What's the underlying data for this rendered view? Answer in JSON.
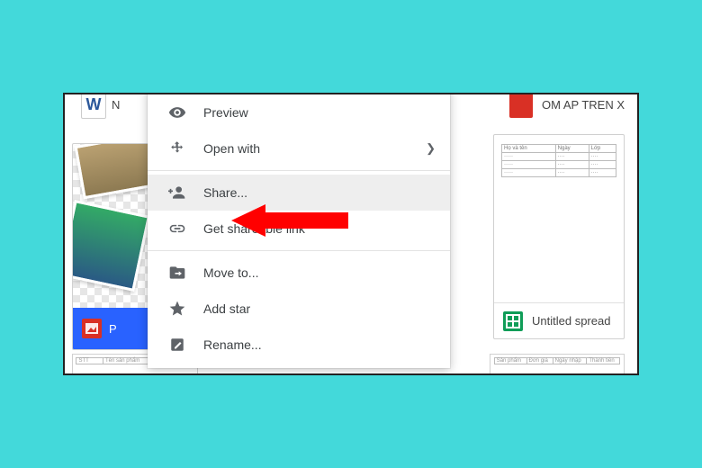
{
  "top_left": {
    "w_label": "W",
    "name_fragment": "N"
  },
  "top_right": {
    "name_fragment": "OM AP TREN X"
  },
  "photo_card": {
    "footer_label": "P"
  },
  "right_card": {
    "footer_label": "Untitled spread",
    "table_headers": [
      "Họ và tên",
      "Ngày",
      "Lớp"
    ]
  },
  "context_menu": {
    "preview": "Preview",
    "open_with": "Open with",
    "share": "Share...",
    "get_link": "Get shareable link",
    "move_to": "Move to...",
    "add_star": "Add star",
    "rename": "Rename..."
  }
}
